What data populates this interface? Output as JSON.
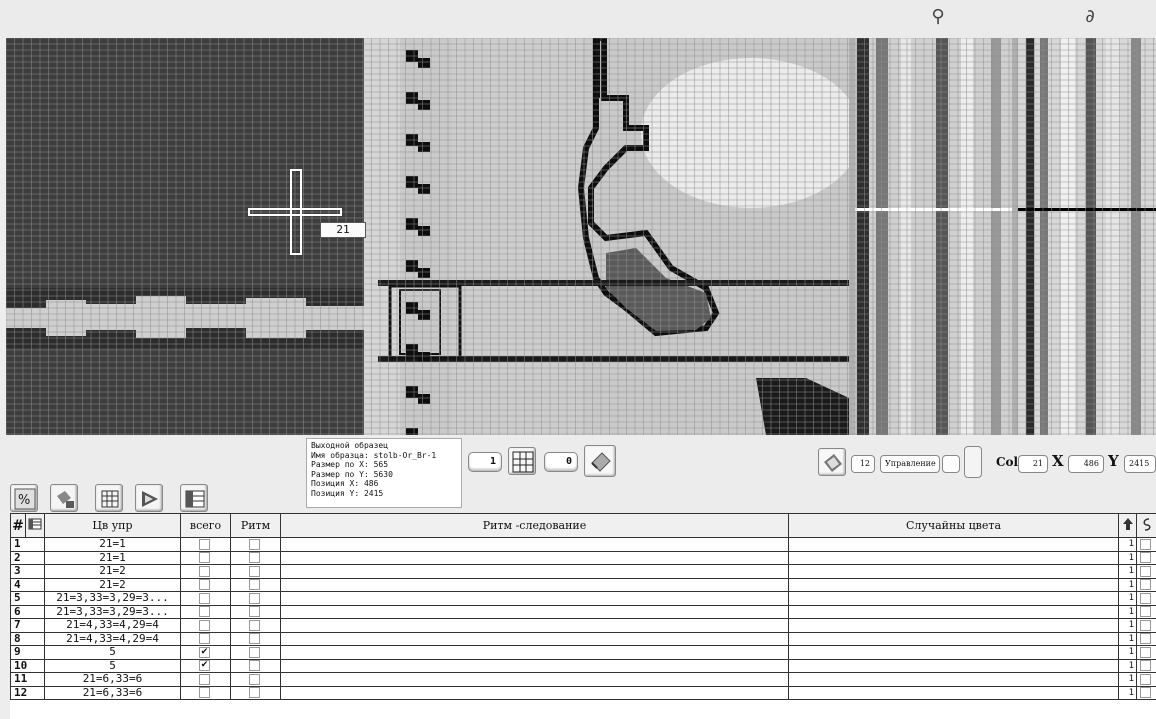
{
  "top_icons": [
    {
      "name": "small-shuttle-icon",
      "glyph": "⚲"
    },
    {
      "name": "hook-icon",
      "glyph": "∂"
    }
  ],
  "canvas": {
    "hor_value": "21",
    "colors": {
      "dark": "#3d3d3d",
      "mid": "#5a5a5a",
      "light": "#c8c8c8",
      "pale": "#e2e2e2",
      "black": "#0d0d0d"
    }
  },
  "info": {
    "title": "Выходной образец",
    "name_line": "Имя образца: stolb-Or_Br-1",
    "size_x": "Размер по X: 565",
    "size_y": "Размер по Y: 5630",
    "pos_x": "Позиция X: 486",
    "pos_y": "Позиция Y: 2415"
  },
  "controls": {
    "field1": "1",
    "field2": "0",
    "count": "12",
    "mode_label": "Управление",
    "col_label": "Col",
    "col_value": "21",
    "x_label": "X",
    "x_value": "486",
    "y_label": "Y",
    "y_value": "2415"
  },
  "table": {
    "headers": {
      "num": "#",
      "color_ctrl": "Цв упр",
      "total": "всего",
      "rhythm": "Ритм",
      "rhythm_seq": "Ритм -следование",
      "random": "Случайны цвета"
    },
    "rows": [
      {
        "num": "1",
        "cu": "21=1",
        "total": "",
        "rhythm": "",
        "seq": "",
        "random": "",
        "v": "1"
      },
      {
        "num": "2",
        "cu": "21=1",
        "total": "",
        "rhythm": "",
        "seq": "",
        "random": "",
        "v": "1"
      },
      {
        "num": "3",
        "cu": "21=2",
        "total": "",
        "rhythm": "",
        "seq": "",
        "random": "",
        "v": "1"
      },
      {
        "num": "4",
        "cu": "21=2",
        "total": "",
        "rhythm": "",
        "seq": "",
        "random": "",
        "v": "1"
      },
      {
        "num": "5",
        "cu": "21=3,33=3,29=3...",
        "total": "",
        "rhythm": "",
        "seq": "",
        "random": "",
        "v": "1"
      },
      {
        "num": "6",
        "cu": "21=3,33=3,29=3...",
        "total": "",
        "rhythm": "",
        "seq": "",
        "random": "",
        "v": "1"
      },
      {
        "num": "7",
        "cu": "21=4,33=4,29=4",
        "total": "",
        "rhythm": "",
        "seq": "",
        "random": "",
        "v": "1"
      },
      {
        "num": "8",
        "cu": "21=4,33=4,29=4",
        "total": "",
        "rhythm": "",
        "seq": "",
        "random": "",
        "v": "1"
      },
      {
        "num": "9",
        "cu": "5",
        "total": "✔",
        "rhythm": "",
        "seq": "",
        "random": "",
        "v": "1"
      },
      {
        "num": "10",
        "cu": "5",
        "total": "✔",
        "rhythm": "",
        "seq": "",
        "random": "",
        "v": "1"
      },
      {
        "num": "11",
        "cu": "21=6,33=6",
        "total": "",
        "rhythm": "",
        "seq": "",
        "random": "",
        "v": "1"
      },
      {
        "num": "12",
        "cu": "21=6,33=6",
        "total": "",
        "rhythm": "",
        "seq": "",
        "random": "",
        "v": "1"
      }
    ]
  }
}
